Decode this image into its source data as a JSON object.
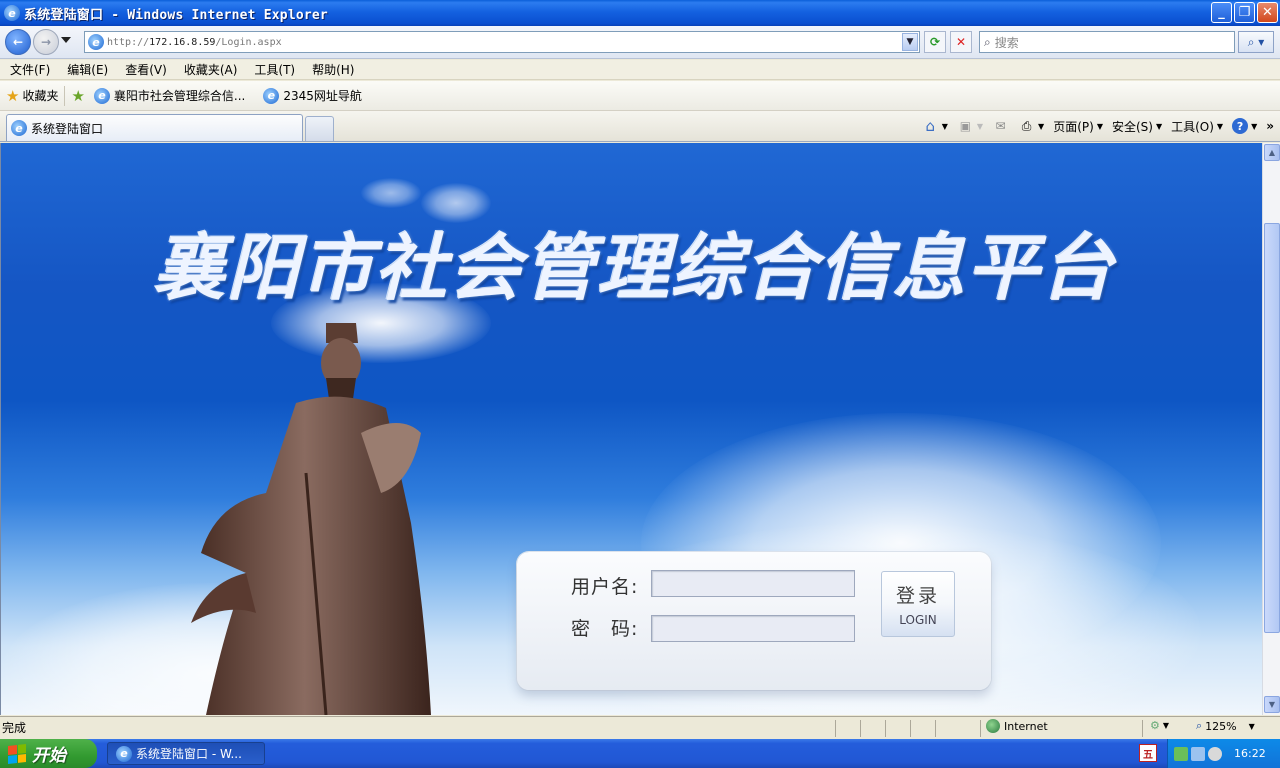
{
  "window": {
    "title": "系统登陆窗口 - Windows Internet Explorer",
    "min_label": "_",
    "max_label": "❐",
    "close_label": "✕"
  },
  "address": {
    "url_prefix": "http://",
    "url_host": "172.16.8.59",
    "url_path": "/Login.aspx",
    "search_placeholder": "搜索"
  },
  "menu": {
    "items": [
      "文件(F)",
      "编辑(E)",
      "查看(V)",
      "收藏夹(A)",
      "工具(T)",
      "帮助(H)"
    ]
  },
  "favorites": {
    "label": "收藏夹",
    "links": [
      "襄阳市社会管理综合信...",
      "2345网址导航"
    ]
  },
  "tabs": {
    "active": "系统登陆窗口"
  },
  "commands": {
    "page": "页面(P)",
    "safety": "安全(S)",
    "tools": "工具(O)"
  },
  "page": {
    "headline": "襄阳市社会管理综合信息平台",
    "username_label": "用户名:",
    "password_label": "密　码:",
    "login_cn": "登录",
    "login_en": "LOGIN"
  },
  "status": {
    "text": "完成",
    "zone": "Internet",
    "zoom": "125%"
  },
  "taskbar": {
    "start": "开始",
    "task": "系统登陆窗口 - W...",
    "clock": "16:22"
  },
  "colors": {
    "sky_top": "#2068d4",
    "sky_bottom": "#f0f6fc",
    "titlebar": "#0a4fd0",
    "taskbar": "#245ddb"
  }
}
